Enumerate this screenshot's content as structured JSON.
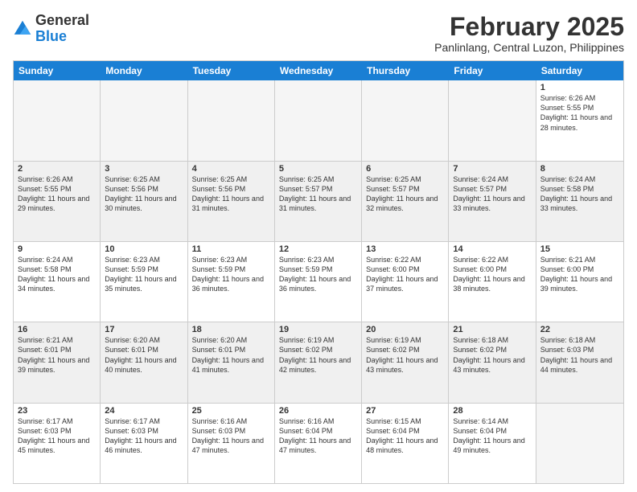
{
  "logo": {
    "general": "General",
    "blue": "Blue"
  },
  "title": {
    "month_year": "February 2025",
    "location": "Panlinlang, Central Luzon, Philippines"
  },
  "days": [
    "Sunday",
    "Monday",
    "Tuesday",
    "Wednesday",
    "Thursday",
    "Friday",
    "Saturday"
  ],
  "rows": [
    [
      {
        "day": "",
        "empty": true
      },
      {
        "day": "",
        "empty": true
      },
      {
        "day": "",
        "empty": true
      },
      {
        "day": "",
        "empty": true
      },
      {
        "day": "",
        "empty": true
      },
      {
        "day": "",
        "empty": true
      },
      {
        "day": "1",
        "sunrise": "6:26 AM",
        "sunset": "5:55 PM",
        "daylight": "11 hours and 28 minutes."
      }
    ],
    [
      {
        "day": "2",
        "sunrise": "6:26 AM",
        "sunset": "5:55 PM",
        "daylight": "11 hours and 29 minutes."
      },
      {
        "day": "3",
        "sunrise": "6:25 AM",
        "sunset": "5:56 PM",
        "daylight": "11 hours and 30 minutes."
      },
      {
        "day": "4",
        "sunrise": "6:25 AM",
        "sunset": "5:56 PM",
        "daylight": "11 hours and 31 minutes."
      },
      {
        "day": "5",
        "sunrise": "6:25 AM",
        "sunset": "5:57 PM",
        "daylight": "11 hours and 31 minutes."
      },
      {
        "day": "6",
        "sunrise": "6:25 AM",
        "sunset": "5:57 PM",
        "daylight": "11 hours and 32 minutes."
      },
      {
        "day": "7",
        "sunrise": "6:24 AM",
        "sunset": "5:57 PM",
        "daylight": "11 hours and 33 minutes."
      },
      {
        "day": "8",
        "sunrise": "6:24 AM",
        "sunset": "5:58 PM",
        "daylight": "11 hours and 33 minutes."
      }
    ],
    [
      {
        "day": "9",
        "sunrise": "6:24 AM",
        "sunset": "5:58 PM",
        "daylight": "11 hours and 34 minutes."
      },
      {
        "day": "10",
        "sunrise": "6:23 AM",
        "sunset": "5:59 PM",
        "daylight": "11 hours and 35 minutes."
      },
      {
        "day": "11",
        "sunrise": "6:23 AM",
        "sunset": "5:59 PM",
        "daylight": "11 hours and 36 minutes."
      },
      {
        "day": "12",
        "sunrise": "6:23 AM",
        "sunset": "5:59 PM",
        "daylight": "11 hours and 36 minutes."
      },
      {
        "day": "13",
        "sunrise": "6:22 AM",
        "sunset": "6:00 PM",
        "daylight": "11 hours and 37 minutes."
      },
      {
        "day": "14",
        "sunrise": "6:22 AM",
        "sunset": "6:00 PM",
        "daylight": "11 hours and 38 minutes."
      },
      {
        "day": "15",
        "sunrise": "6:21 AM",
        "sunset": "6:00 PM",
        "daylight": "11 hours and 39 minutes."
      }
    ],
    [
      {
        "day": "16",
        "sunrise": "6:21 AM",
        "sunset": "6:01 PM",
        "daylight": "11 hours and 39 minutes."
      },
      {
        "day": "17",
        "sunrise": "6:20 AM",
        "sunset": "6:01 PM",
        "daylight": "11 hours and 40 minutes."
      },
      {
        "day": "18",
        "sunrise": "6:20 AM",
        "sunset": "6:01 PM",
        "daylight": "11 hours and 41 minutes."
      },
      {
        "day": "19",
        "sunrise": "6:19 AM",
        "sunset": "6:02 PM",
        "daylight": "11 hours and 42 minutes."
      },
      {
        "day": "20",
        "sunrise": "6:19 AM",
        "sunset": "6:02 PM",
        "daylight": "11 hours and 43 minutes."
      },
      {
        "day": "21",
        "sunrise": "6:18 AM",
        "sunset": "6:02 PM",
        "daylight": "11 hours and 43 minutes."
      },
      {
        "day": "22",
        "sunrise": "6:18 AM",
        "sunset": "6:03 PM",
        "daylight": "11 hours and 44 minutes."
      }
    ],
    [
      {
        "day": "23",
        "sunrise": "6:17 AM",
        "sunset": "6:03 PM",
        "daylight": "11 hours and 45 minutes."
      },
      {
        "day": "24",
        "sunrise": "6:17 AM",
        "sunset": "6:03 PM",
        "daylight": "11 hours and 46 minutes."
      },
      {
        "day": "25",
        "sunrise": "6:16 AM",
        "sunset": "6:03 PM",
        "daylight": "11 hours and 47 minutes."
      },
      {
        "day": "26",
        "sunrise": "6:16 AM",
        "sunset": "6:04 PM",
        "daylight": "11 hours and 47 minutes."
      },
      {
        "day": "27",
        "sunrise": "6:15 AM",
        "sunset": "6:04 PM",
        "daylight": "11 hours and 48 minutes."
      },
      {
        "day": "28",
        "sunrise": "6:14 AM",
        "sunset": "6:04 PM",
        "daylight": "11 hours and 49 minutes."
      },
      {
        "day": "",
        "empty": true
      }
    ]
  ]
}
